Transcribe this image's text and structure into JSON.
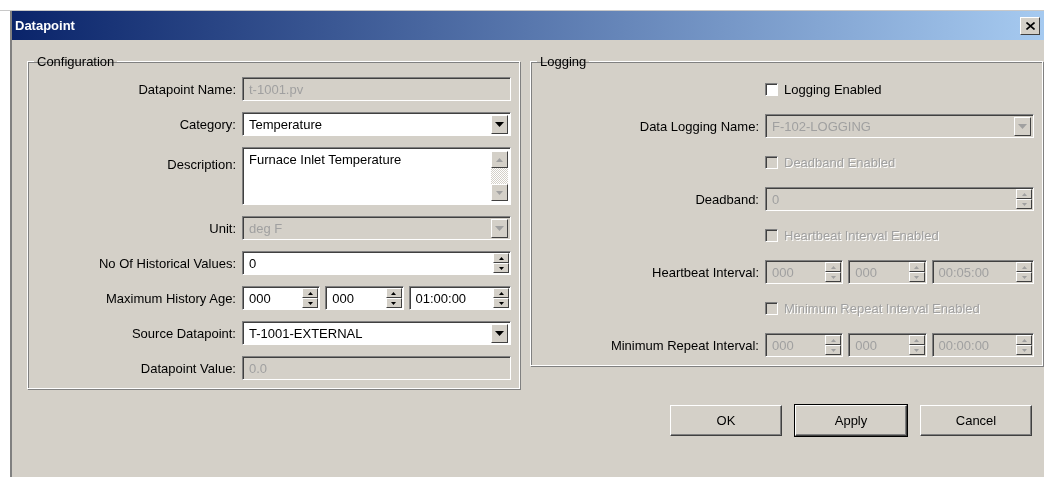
{
  "window": {
    "title": "Datapoint"
  },
  "configuration": {
    "title": "Configuration",
    "rows": [
      {
        "kind": "text",
        "label": "Datapoint Name:",
        "value": "t-1001.pv",
        "disabled": true
      },
      {
        "kind": "combo",
        "label": "Category:",
        "value": "Temperature",
        "disabled": false
      },
      {
        "kind": "textarea",
        "label": "Description:",
        "value": "Furnace Inlet Temperature",
        "disabled": false
      },
      {
        "kind": "combo",
        "label": "Unit:",
        "value": "deg F",
        "disabled": true
      },
      {
        "kind": "spin",
        "label": "No Of Historical Values:",
        "value": "0",
        "disabled": false
      },
      {
        "kind": "spin3",
        "label": "Maximum History Age:",
        "values": [
          "000",
          "000",
          "01:00:00"
        ],
        "disabled": false
      },
      {
        "kind": "combo",
        "label": "Source Datapoint:",
        "value": "T-1001-EXTERNAL",
        "disabled": false
      },
      {
        "kind": "text",
        "label": "Datapoint Value:",
        "value": "0.0",
        "disabled": true
      }
    ]
  },
  "logging": {
    "title": "Logging",
    "rows": [
      {
        "kind": "checkbox",
        "label": "Logging Enabled",
        "checked": false,
        "disabled": false
      },
      {
        "kind": "combo",
        "label": "Data Logging Name:",
        "value": "F-102-LOGGING",
        "disabled": true
      },
      {
        "kind": "checkbox",
        "label": "Deadband Enabled",
        "checked": false,
        "disabled": true
      },
      {
        "kind": "spin",
        "label": "Deadband:",
        "value": "0",
        "disabled": true
      },
      {
        "kind": "checkbox",
        "label": "Heartbeat Interval Enabled",
        "checked": false,
        "disabled": true
      },
      {
        "kind": "spin3",
        "label": "Heartbeat Interval:",
        "values": [
          "000",
          "000",
          "00:05:00"
        ],
        "disabled": true
      },
      {
        "kind": "checkbox",
        "label": "Minimum Repeat Interval Enabled",
        "checked": false,
        "disabled": true
      },
      {
        "kind": "spin3",
        "label": "Minimum Repeat Interval:",
        "values": [
          "000",
          "000",
          "00:00:00"
        ],
        "disabled": true
      }
    ]
  },
  "buttons": [
    {
      "label": "OK",
      "default": false
    },
    {
      "label": "Apply",
      "default": true
    },
    {
      "label": "Cancel",
      "default": false
    }
  ]
}
